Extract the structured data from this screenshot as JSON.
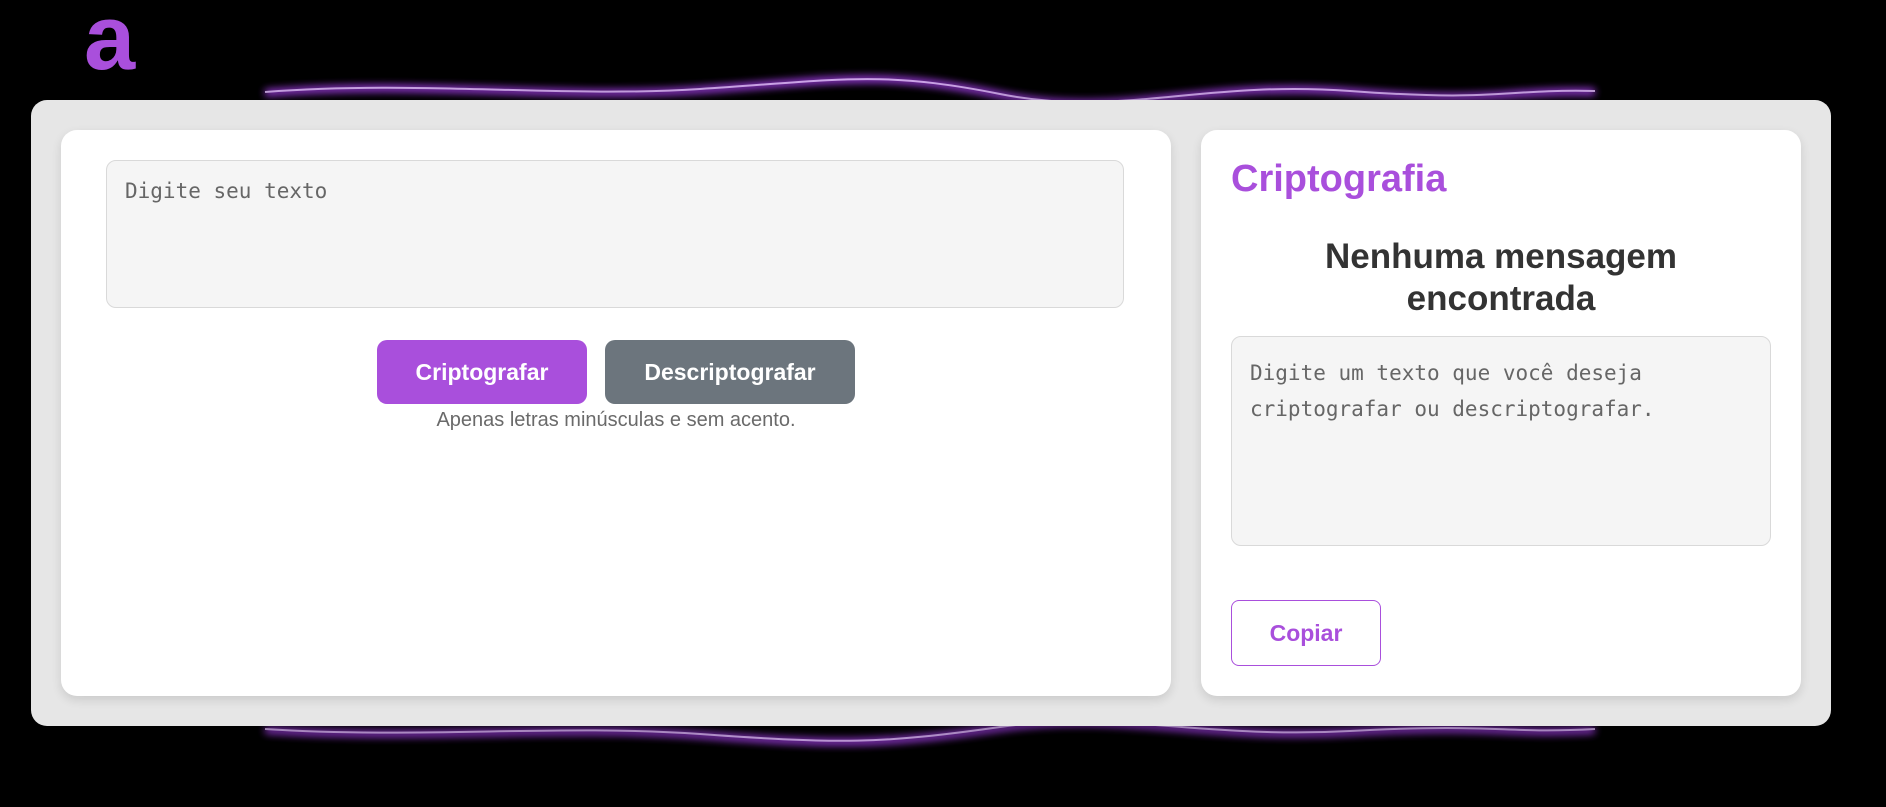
{
  "brand": {
    "logo_letter": "a",
    "accent_color": "#a94fdc",
    "secondary_color": "#6c757d"
  },
  "input": {
    "placeholder": "Digite seu texto"
  },
  "buttons": {
    "encrypt_label": "Criptografar",
    "decrypt_label": "Descriptografar"
  },
  "hint": "Apenas letras minúsculas e sem acento.",
  "output": {
    "title": "Criptografia",
    "heading": "Nenhuma mensagem encontrada",
    "placeholder": "Digite um texto que você deseja criptografar ou descriptografar.",
    "copy_label": "Copiar"
  }
}
